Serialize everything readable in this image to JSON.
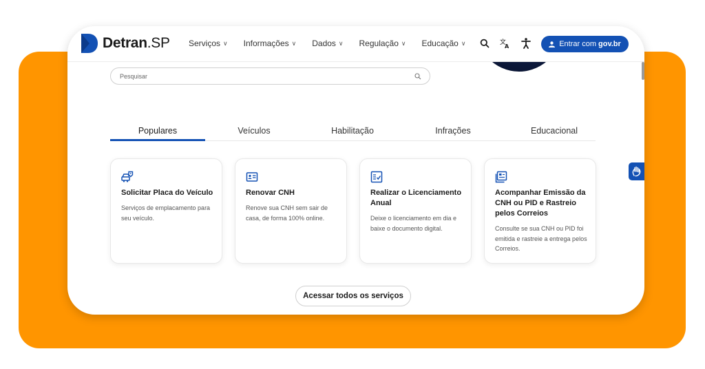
{
  "header": {
    "logo": {
      "name": "Detran",
      "suffix": ".SP"
    },
    "nav": [
      {
        "label": "Serviços"
      },
      {
        "label": "Informações"
      },
      {
        "label": "Dados"
      },
      {
        "label": "Regulação"
      },
      {
        "label": "Educação"
      }
    ],
    "icons": [
      "search-icon",
      "translate-icon",
      "accessibility-icon"
    ],
    "login": {
      "prefix": "Entrar com",
      "gov": "gov.br"
    }
  },
  "search": {
    "placeholder": "Pesquisar"
  },
  "tabs": [
    {
      "label": "Populares",
      "active": true
    },
    {
      "label": "Veículos"
    },
    {
      "label": "Habilitação"
    },
    {
      "label": "Infrações"
    },
    {
      "label": "Educacional"
    }
  ],
  "cards": [
    {
      "icon": "vehicle-plate-icon",
      "title": "Solicitar Placa do Veículo",
      "desc": "Serviços de emplacamento para seu veículo."
    },
    {
      "icon": "license-card-icon",
      "title": "Renovar CNH",
      "desc": "Renove sua CNH sem sair de casa, de forma 100% online."
    },
    {
      "icon": "checklist-document-icon",
      "title": "Realizar o Licenciamento Anual",
      "desc": "Deixe o licenciamento em dia e baixe o documento digital."
    },
    {
      "icon": "tracking-document-icon",
      "title": "Acompanhar Emissão da CNH ou PID e Rastreio pelos Correios",
      "desc": "Consulte se sua CNH ou PID foi emitida e rastreie a entrega pelos Correios."
    }
  ],
  "cta": {
    "label": "Acessar todos os serviços"
  },
  "colors": {
    "brand": "#1351b4",
    "background": "#ff9500"
  }
}
